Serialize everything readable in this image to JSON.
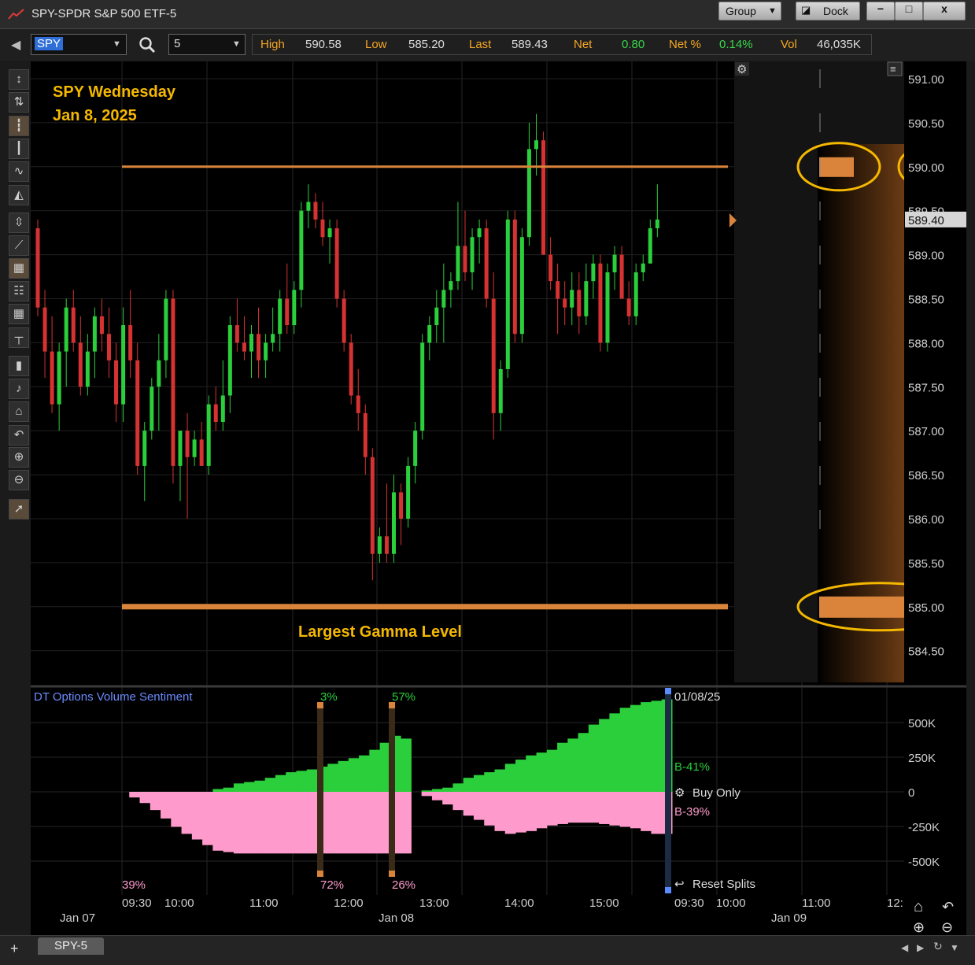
{
  "window": {
    "title": "SPY-SPDR S&P 500 ETF-5",
    "group_label": "Group",
    "dock_label": "Dock",
    "minimize_label": "−",
    "maximize_label": "□",
    "close_label": "x"
  },
  "toolbar": {
    "symbol": "SPY",
    "interval": "5",
    "stats": [
      {
        "label": "High",
        "value": "590.58"
      },
      {
        "label": "Low",
        "value": "585.20"
      },
      {
        "label": "Last",
        "value": "589.43"
      },
      {
        "label": "Net",
        "value": "0.80"
      },
      {
        "label": "Net %",
        "value": "0.14%"
      },
      {
        "label": "Vol",
        "value": "46,035K"
      }
    ]
  },
  "tools": [
    "cursor-cross",
    "cursor-bars",
    "candle-style",
    "bar-style",
    "line-style",
    "area-style",
    "fit-scale",
    "trendline",
    "grid-dense",
    "table",
    "grid",
    "crosshair",
    "pin",
    "note",
    "home",
    "undo",
    "zoom-in",
    "zoom-out",
    "select-arrow"
  ],
  "colors": {
    "up": "#2bcf3b",
    "down": "#d63232",
    "level": "#d9843a",
    "annotation": "#f5b800",
    "buy": "#2bcf3b",
    "sell": "#ff9bcc"
  },
  "annotations": {
    "title_line1": "SPY Wednesday",
    "title_line2": "Jan 8, 2025",
    "gamma_label": "Largest Gamma Level"
  },
  "price_axis": {
    "ticks": [
      "591.00",
      "590.50",
      "590.00",
      "589.50",
      "589.00",
      "588.50",
      "588.00",
      "587.50",
      "587.00",
      "586.50",
      "586.00",
      "585.50",
      "585.00",
      "584.50"
    ],
    "last_price": "589.40"
  },
  "sentiment": {
    "title": "DT Options Volume Sentiment",
    "date": "01/08/25",
    "buy_pct": "B-41%",
    "sell_pct": "B-39%",
    "buy_only_label": "Buy Only",
    "reset_label": "Reset Splits",
    "split_top": [
      "3%",
      "57%"
    ],
    "split_bottom": [
      "39%",
      "72%",
      "26%"
    ],
    "y_ticks": [
      "500K",
      "250K",
      "0",
      "-250K",
      "-500K"
    ]
  },
  "time_axis": {
    "times": [
      "09:30",
      "10:00",
      "11:00",
      "12:00",
      "13:00",
      "14:00",
      "15:00",
      "09:30",
      "10:00",
      "11:00",
      "12:"
    ],
    "dates": [
      "Jan 07",
      "Jan 08",
      "Jan 09"
    ]
  },
  "bottom_tab": "SPY-5",
  "chart_data": {
    "type": "candlestick",
    "title": "SPY-SPDR S&P 500 ETF-5",
    "interval": "5 minute",
    "date": "Jan 8, 2025",
    "ylim": [
      584.3,
      591.1
    ],
    "levels": [
      {
        "price": 590.0,
        "label": ""
      },
      {
        "price": 585.0,
        "label": "Largest Gamma Level"
      }
    ],
    "ohlc": [
      [
        589.3,
        589.4,
        588.3,
        588.4
      ],
      [
        588.4,
        588.6,
        587.6,
        587.9
      ],
      [
        587.9,
        588.3,
        587.2,
        587.3
      ],
      [
        587.3,
        588.0,
        587.0,
        587.9
      ],
      [
        587.9,
        588.5,
        587.5,
        588.4
      ],
      [
        588.4,
        588.6,
        587.9,
        588.0
      ],
      [
        588.0,
        588.3,
        587.4,
        587.5
      ],
      [
        587.5,
        588.1,
        587.4,
        587.9
      ],
      [
        587.9,
        588.4,
        587.6,
        588.3
      ],
      [
        588.3,
        588.5,
        587.9,
        588.1
      ],
      [
        588.1,
        588.4,
        587.6,
        587.8
      ],
      [
        587.8,
        588.0,
        587.1,
        587.3
      ],
      [
        587.3,
        588.4,
        587.1,
        588.2
      ],
      [
        588.2,
        588.6,
        587.6,
        587.8
      ],
      [
        587.8,
        588.0,
        586.5,
        586.6
      ],
      [
        586.6,
        587.1,
        586.2,
        587.0
      ],
      [
        587.0,
        587.6,
        586.9,
        587.5
      ],
      [
        587.5,
        588.1,
        587.0,
        587.8
      ],
      [
        587.8,
        588.6,
        587.6,
        588.5
      ],
      [
        588.5,
        588.6,
        586.4,
        586.6
      ],
      [
        586.6,
        587.0,
        586.2,
        587.0
      ],
      [
        587.0,
        587.2,
        586.0,
        586.7
      ],
      [
        586.7,
        587.0,
        586.6,
        586.9
      ],
      [
        586.9,
        587.1,
        586.6,
        586.6
      ],
      [
        586.6,
        587.4,
        586.5,
        587.3
      ],
      [
        587.3,
        587.5,
        587.0,
        587.1
      ],
      [
        587.1,
        587.8,
        587.0,
        587.4
      ],
      [
        587.4,
        588.3,
        587.2,
        588.2
      ],
      [
        588.2,
        588.5,
        587.9,
        588.0
      ],
      [
        588.0,
        588.3,
        587.8,
        587.9
      ],
      [
        587.9,
        588.2,
        587.6,
        588.1
      ],
      [
        588.1,
        588.4,
        587.6,
        587.8
      ],
      [
        587.8,
        588.1,
        587.6,
        588.0
      ],
      [
        588.0,
        588.4,
        587.9,
        588.1
      ],
      [
        588.1,
        588.6,
        587.9,
        588.5
      ],
      [
        588.5,
        588.9,
        588.1,
        588.2
      ],
      [
        588.2,
        588.7,
        588.1,
        588.6
      ],
      [
        588.6,
        589.6,
        588.4,
        589.5
      ],
      [
        589.5,
        589.8,
        589.3,
        589.6
      ],
      [
        589.6,
        589.7,
        589.3,
        589.4
      ],
      [
        589.4,
        589.6,
        589.1,
        589.2
      ],
      [
        589.2,
        589.4,
        588.9,
        589.3
      ],
      [
        589.3,
        589.4,
        588.4,
        588.5
      ],
      [
        588.5,
        588.6,
        587.9,
        588.0
      ],
      [
        588.0,
        588.1,
        587.3,
        587.4
      ],
      [
        587.4,
        587.7,
        587.0,
        587.2
      ],
      [
        587.2,
        587.3,
        586.5,
        586.7
      ],
      [
        586.7,
        586.8,
        585.3,
        585.6
      ],
      [
        585.6,
        585.9,
        585.5,
        585.8
      ],
      [
        585.8,
        586.4,
        585.5,
        585.6
      ],
      [
        585.6,
        586.5,
        585.5,
        586.3
      ],
      [
        586.3,
        586.4,
        585.7,
        586.0
      ],
      [
        586.0,
        586.7,
        585.9,
        586.6
      ],
      [
        586.6,
        587.1,
        586.4,
        587.0
      ],
      [
        587.0,
        588.1,
        586.9,
        588.0
      ],
      [
        588.0,
        588.3,
        587.8,
        588.2
      ],
      [
        588.2,
        588.6,
        588.0,
        588.4
      ],
      [
        588.4,
        588.9,
        588.0,
        588.6
      ],
      [
        588.6,
        588.8,
        588.4,
        588.7
      ],
      [
        588.7,
        589.6,
        588.6,
        589.1
      ],
      [
        589.1,
        589.5,
        588.7,
        588.8
      ],
      [
        588.8,
        589.3,
        588.6,
        589.2
      ],
      [
        589.2,
        589.4,
        588.9,
        589.3
      ],
      [
        589.3,
        589.4,
        588.4,
        588.5
      ],
      [
        588.5,
        588.8,
        586.9,
        587.2
      ],
      [
        587.2,
        587.8,
        587.0,
        587.7
      ],
      [
        587.7,
        589.5,
        587.6,
        589.4
      ],
      [
        589.4,
        589.5,
        588.0,
        588.1
      ],
      [
        588.1,
        589.3,
        588.0,
        589.2
      ],
      [
        589.2,
        590.5,
        589.1,
        590.2
      ],
      [
        590.2,
        590.6,
        589.9,
        590.3
      ],
      [
        590.3,
        590.4,
        589.0,
        589.0
      ],
      [
        589.0,
        589.2,
        588.6,
        588.7
      ],
      [
        588.7,
        588.9,
        588.1,
        588.5
      ],
      [
        588.5,
        588.7,
        588.2,
        588.4
      ],
      [
        588.4,
        588.8,
        588.2,
        588.6
      ],
      [
        588.6,
        588.8,
        588.1,
        588.3
      ],
      [
        588.3,
        588.9,
        588.2,
        588.7
      ],
      [
        588.7,
        589.0,
        588.5,
        588.9
      ],
      [
        588.9,
        589.0,
        587.9,
        588.0
      ],
      [
        588.0,
        588.9,
        587.9,
        588.8
      ],
      [
        588.8,
        589.1,
        588.6,
        589.0
      ],
      [
        589.0,
        589.1,
        588.5,
        588.5
      ],
      [
        588.5,
        588.7,
        588.2,
        588.3
      ],
      [
        588.3,
        588.9,
        588.2,
        588.8
      ],
      [
        588.8,
        589.0,
        588.7,
        588.9
      ],
      [
        588.9,
        589.4,
        588.9,
        589.3
      ],
      [
        589.3,
        589.8,
        589.2,
        589.4
      ]
    ],
    "sentiment_series": [
      {
        "name": "Buy",
        "values": [
          0,
          0,
          0,
          0,
          0,
          0,
          0,
          0,
          0,
          20,
          30,
          60,
          70,
          80,
          100,
          120,
          140,
          150,
          160,
          180,
          200,
          220,
          240,
          260,
          300,
          350,
          400,
          380,
          0,
          10,
          20,
          30,
          60,
          100,
          120,
          140,
          160,
          200,
          230,
          260,
          280,
          300,
          350,
          380,
          420,
          480,
          520,
          560,
          600,
          620,
          640,
          650,
          660
        ]
      },
      {
        "name": "Sell",
        "values": [
          0,
          -40,
          -80,
          -130,
          -190,
          -250,
          -300,
          -340,
          -380,
          -420,
          -430,
          -440,
          -440,
          -440,
          -440,
          -440,
          -440,
          -440,
          -440,
          -440,
          -440,
          -440,
          -440,
          -440,
          -440,
          -440,
          -440,
          -440,
          0,
          -30,
          -60,
          -90,
          -130,
          -170,
          -200,
          -240,
          -280,
          -300,
          -290,
          -280,
          -260,
          -240,
          -230,
          -220,
          -220,
          -220,
          -230,
          -240,
          -250,
          -260,
          -280,
          -300,
          -300
        ]
      }
    ]
  }
}
